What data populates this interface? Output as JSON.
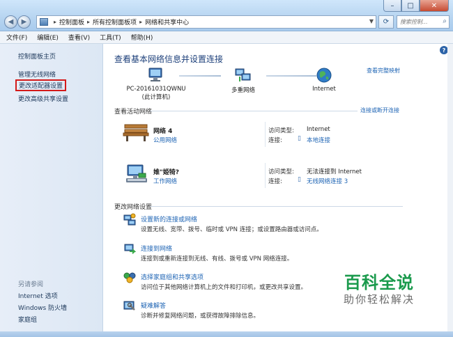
{
  "window": {
    "controls": {
      "minimize": "–",
      "maximize": "□",
      "close": "✕"
    }
  },
  "address": {
    "crumbs": [
      "控制面板",
      "所有控制面板项",
      "网络和共享中心"
    ],
    "search_placeholder": "搜索控制..."
  },
  "menu": [
    "文件(F)",
    "编辑(E)",
    "查看(V)",
    "工具(T)",
    "帮助(H)"
  ],
  "sidebar": {
    "items": [
      {
        "label": "控制面板主页"
      },
      {
        "label": "管理无线网络"
      },
      {
        "label": "更改适配器设置",
        "highlighted": true
      },
      {
        "label": "更改高级共享设置"
      }
    ],
    "see_also_heading": "另请参阅",
    "see_also": [
      "Internet 选项",
      "Windows 防火墙",
      "家庭组"
    ]
  },
  "main": {
    "title": "查看基本网络信息并设置连接",
    "full_map_link": "查看完整映射",
    "map": {
      "computer_name": "PC-20161031QWNU",
      "computer_sub": "(此计算机)",
      "middle": "多重网络",
      "internet": "Internet"
    },
    "active_heading": "查看活动网络",
    "connect_link": "连接或断开连接",
    "networks": [
      {
        "name": "网络  4",
        "type": "公用网络",
        "access_label": "访问类型:",
        "access_value": "Internet",
        "conn_label": "连接:",
        "conn_value": "本地连接"
      },
      {
        "name": "婎\"姫犄?",
        "type": "工作网络",
        "access_label": "访问类型:",
        "access_value": "无法连接到 Internet",
        "conn_label": "连接:",
        "conn_value": "无线网络连接 3"
      }
    ],
    "change_heading": "更改网络设置",
    "tasks": [
      {
        "title": "设置新的连接或网络",
        "desc": "设置无线、宽带、拨号、临时或 VPN 连接；或设置路由器或访问点。"
      },
      {
        "title": "连接到网络",
        "desc": "连接到或重新连接到无线、有线、拨号或 VPN 网络连接。"
      },
      {
        "title": "选择家庭组和共享选项",
        "desc": "访问位于其他网络计算机上的文件和打印机，或更改共享设置。"
      },
      {
        "title": "疑难解答",
        "desc": "诊断并修复网络问题，或获得故障排除信息。"
      }
    ],
    "help": "?"
  },
  "watermark": {
    "title": "百科全说",
    "subtitle": "助你轻松解决"
  },
  "colors": {
    "link": "#1e64b4",
    "title": "#1c3f7a",
    "highlight_border": "#d41a1a",
    "watermark": "#1a9a4c"
  }
}
